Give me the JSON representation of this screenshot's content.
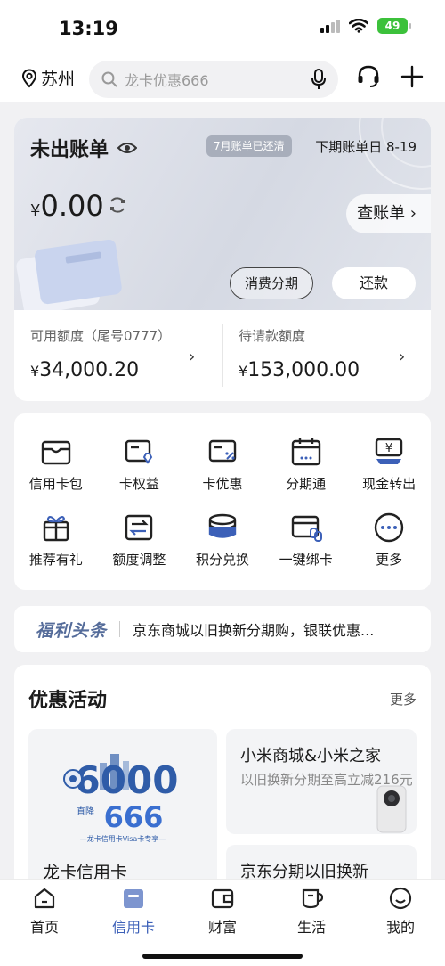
{
  "status_bar": {
    "time": "13:19",
    "battery": "49"
  },
  "top_bar": {
    "city": "苏州",
    "search_placeholder": "龙卡优惠666"
  },
  "bill": {
    "title": "未出账单",
    "paid_tag": "7月账单已还清",
    "next_bill": "下期账单日 8-19",
    "currency": "¥",
    "amount": "0.00",
    "check_bill": "查账单 ›",
    "btn_installment": "消费分期",
    "btn_repay": "还款",
    "available_label": "可用额度（尾号0777）",
    "available_value": "34,000.20",
    "pending_label": "待请款额度",
    "pending_value": "153,000.00"
  },
  "functions": [
    {
      "label": "信用卡包",
      "icon": "wallet-icon"
    },
    {
      "label": "卡权益",
      "icon": "card-benefit-icon"
    },
    {
      "label": "卡优惠",
      "icon": "card-discount-icon"
    },
    {
      "label": "分期通",
      "icon": "calendar-icon"
    },
    {
      "label": "现金转出",
      "icon": "cash-out-icon"
    },
    {
      "label": "推荐有礼",
      "icon": "gift-icon"
    },
    {
      "label": "额度调整",
      "icon": "adjust-icon"
    },
    {
      "label": "积分兑换",
      "icon": "coins-icon"
    },
    {
      "label": "一键绑卡",
      "icon": "bind-card-icon"
    },
    {
      "label": "更多",
      "icon": "more-icon"
    }
  ],
  "news": {
    "tag": "福利头条",
    "text": "京东商城以旧换新分期购，银联优惠..."
  },
  "promo": {
    "title": "优惠活动",
    "more": "更多",
    "big": {
      "title": "龙卡信用卡",
      "art_big": "6000",
      "art_small": "666",
      "art_caption": "—龙卡信用卡Visa卡专享—",
      "art_side": "直降"
    },
    "small1": {
      "title": "小米商城&小米之家",
      "sub": "以旧换新分期至高立减216元"
    },
    "small2": {
      "title": "京东分期以旧换新"
    }
  },
  "tabs": [
    {
      "label": "首页",
      "icon": "home-icon"
    },
    {
      "label": "信用卡",
      "icon": "credit-card-icon"
    },
    {
      "label": "财富",
      "icon": "wealth-icon"
    },
    {
      "label": "生活",
      "icon": "life-icon"
    },
    {
      "label": "我的",
      "icon": "profile-icon"
    }
  ],
  "colors": {
    "accent": "#3c60b8",
    "news_tag": "#556c9a",
    "battery": "#3cc13b",
    "bill_bg": "#dcdfe7"
  }
}
